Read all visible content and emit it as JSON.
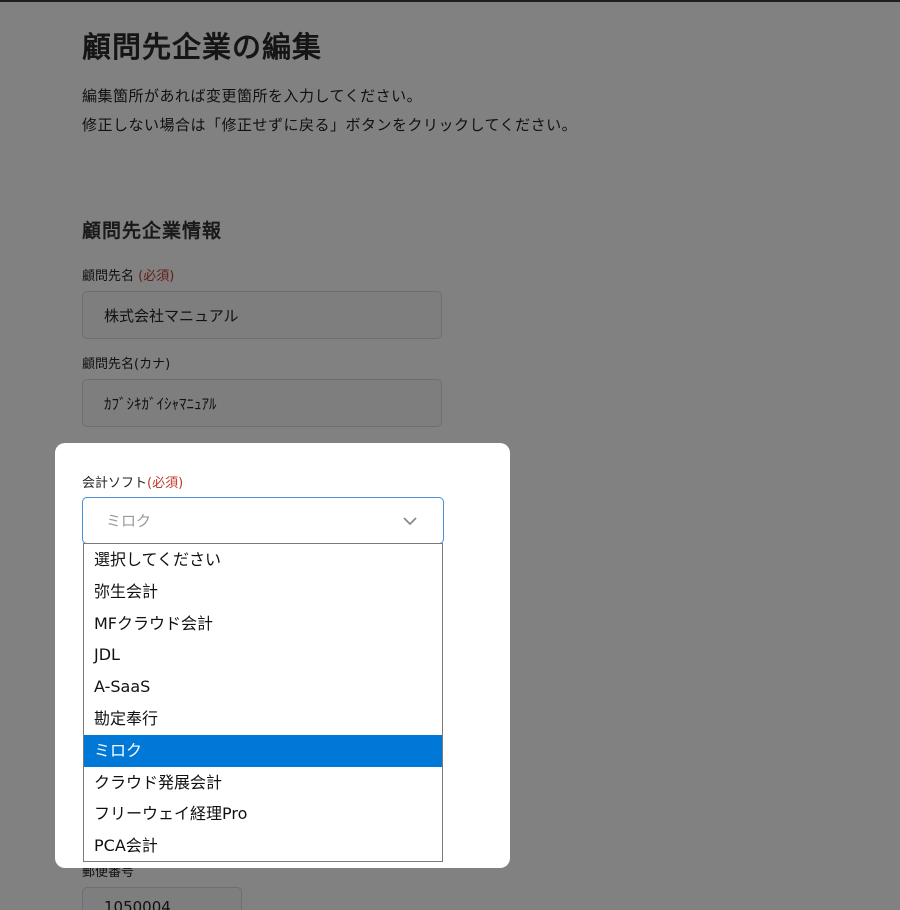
{
  "page": {
    "title": "顧問先企業の編集",
    "intro_line1": "編集箇所があれば変更箇所を入力してください。",
    "intro_line2": "修正しない場合は「修正せずに戻る」ボタンをクリックしてください。",
    "section_title": "顧問先企業情報"
  },
  "fields": {
    "client_name": {
      "label": "顧問先名",
      "required": "(必須)",
      "value": "株式会社マニュアル"
    },
    "client_kana": {
      "label": "顧問先名(カナ)",
      "value": "ｶﾌﾞｼｷｶﾞｲｼｬﾏﾆｭｱﾙ"
    },
    "postal_code": {
      "label": "郵便番号",
      "value": "1050004"
    }
  },
  "accounting_software": {
    "label": "会計ソフト",
    "required": "(必須)",
    "selected": "ミロク",
    "options": [
      "選択してください",
      "弥生会計",
      "MFクラウド会計",
      "JDL",
      "A-SaaS",
      "勘定奉行",
      "ミロク",
      "クラウド発展会計",
      "フリーウェイ経理Pro",
      "PCA会計"
    ],
    "selected_index": 6
  },
  "colors": {
    "required_text": "#c0392b",
    "selected_option": "#0078d7",
    "select_focus_border": "#4a90d9",
    "overlay": "rgba(0,0,0,0.48)"
  },
  "icons": {
    "select_arrow": "chevron-down-icon"
  }
}
